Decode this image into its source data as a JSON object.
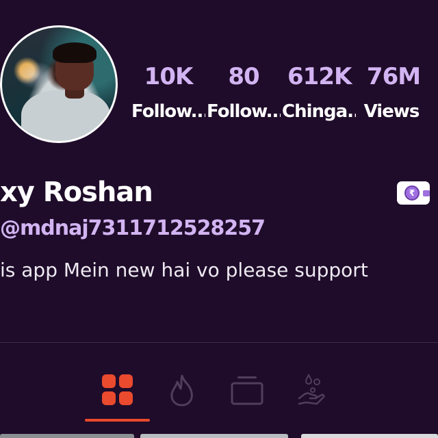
{
  "profile": {
    "display_name": "xy Roshan",
    "handle": "@mdnaj7311712528257",
    "bio": "is app Mein new hai vo please support"
  },
  "stats": [
    {
      "value": "10K",
      "label": "Follow..."
    },
    {
      "value": "80",
      "label": "Follow..."
    },
    {
      "value": "612K",
      "label": "Chinga..."
    },
    {
      "value": "76M",
      "label": "Views"
    }
  ],
  "wallet": {
    "icon": "wallet-rupee-icon",
    "symbol": "₹"
  },
  "tabs": [
    {
      "name": "grid-icon",
      "active": true
    },
    {
      "name": "fire-icon",
      "active": false
    },
    {
      "name": "collection-icon",
      "active": false
    },
    {
      "name": "donate-hand-icon",
      "active": false
    }
  ],
  "colors": {
    "background": "#1f0c2a",
    "accent_purple": "#d2b4f2",
    "active_tab": "#ea4a2e",
    "inactive_tab": "#4f3e5c"
  }
}
